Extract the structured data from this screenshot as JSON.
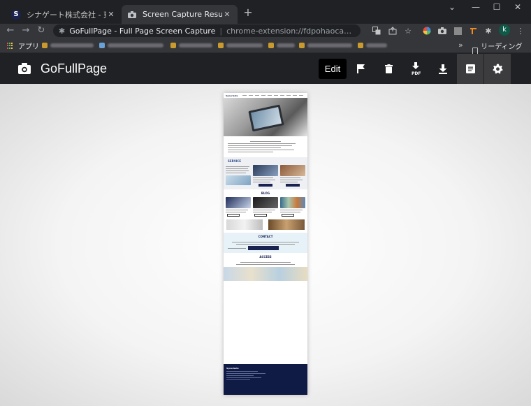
{
  "browser": {
    "tabs": [
      {
        "title": "シナゲート株式会社 - 東京のシステム",
        "favicon": "synergate-logo",
        "active": false
      },
      {
        "title": "Screen Capture Result",
        "favicon": "camera-icon",
        "active": true
      }
    ],
    "window_controls": {
      "dropdown": "⌄",
      "minimize": "—",
      "maximize": "☐",
      "close": "✕"
    },
    "address_bar": {
      "site_name": "GoFullPage - Full Page Screen Capture",
      "url": "chrome-extension://fdpohaocaechififmbbbbbknoalclacl..."
    },
    "bookmarks": {
      "apps_label": "アプリ",
      "reading_list_label": "リーディング リスト"
    },
    "profile_initial": "k"
  },
  "app": {
    "brand_name": "GoFullPage",
    "edit_label": "Edit",
    "pdf_label": "PDF",
    "actions": [
      "flag-icon",
      "trash-icon",
      "download-pdf-icon",
      "download-icon",
      "document-icon",
      "gear-icon"
    ],
    "selected_action": "document-icon"
  },
  "capture": {
    "sections": [
      "SERVICE",
      "BLOG",
      "CONTACT",
      "ACCESS"
    ],
    "footer_logo": "SynerGate"
  },
  "colors": {
    "chrome_dark": "#202124",
    "chrome_toolbar": "#35363a",
    "brand_navy": "#1a2350",
    "footer_navy": "#0f1a45"
  }
}
